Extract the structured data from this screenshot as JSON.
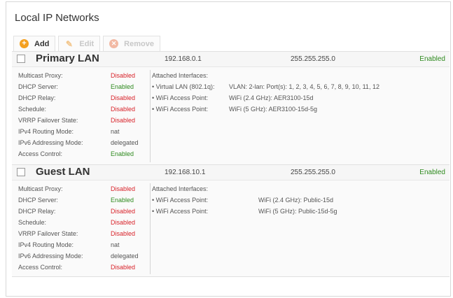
{
  "page": {
    "title": "Local IP Networks"
  },
  "toolbar": {
    "add_label": "Add",
    "edit_label": "Edit",
    "remove_label": "Remove"
  },
  "colors": {
    "enabled": "#2e8a1e",
    "disabled": "#d8232a",
    "add_accent": "#f4a020"
  },
  "networks": [
    {
      "name": "Primary LAN",
      "ip": "192.168.0.1",
      "netmask": "255.255.255.0",
      "state": "Enabled",
      "props": [
        {
          "key": "Multicast Proxy:",
          "value": "Disabled",
          "status": "red"
        },
        {
          "key": "DHCP Server:",
          "value": "Enabled",
          "status": "green"
        },
        {
          "key": "DHCP Relay:",
          "value": "Disabled",
          "status": "red"
        },
        {
          "key": "Schedule:",
          "value": "Disabled",
          "status": "red"
        },
        {
          "key": "VRRP Failover State:",
          "value": "Disabled",
          "status": "red"
        },
        {
          "key": "IPv4 Routing Mode:",
          "value": "nat",
          "status": "plain"
        },
        {
          "key": "IPv6 Addressing Mode:",
          "value": "delegated",
          "status": "plain"
        },
        {
          "key": "Access Control:",
          "value": "Enabled",
          "status": "green"
        }
      ],
      "attached_label": "Attached Interfaces:",
      "interfaces": [
        {
          "type": "• Virtual LAN (802.1q):",
          "detail": "VLAN: 2-lan: Port(s): 1, 2, 3, 4, 5, 6, 7, 8, 9, 10, 11, 12"
        },
        {
          "type": "• WiFi Access Point:",
          "detail": "WiFi (2.4 GHz): AER3100-15d"
        },
        {
          "type": "• WiFi Access Point:",
          "detail": "WiFi (5 GHz): AER3100-15d-5g"
        }
      ]
    },
    {
      "name": "Guest LAN",
      "ip": "192.168.10.1",
      "netmask": "255.255.255.0",
      "state": "Enabled",
      "props": [
        {
          "key": "Multicast Proxy:",
          "value": "Disabled",
          "status": "red"
        },
        {
          "key": "DHCP Server:",
          "value": "Enabled",
          "status": "green"
        },
        {
          "key": "DHCP Relay:",
          "value": "Disabled",
          "status": "red"
        },
        {
          "key": "Schedule:",
          "value": "Disabled",
          "status": "red"
        },
        {
          "key": "VRRP Failover State:",
          "value": "Disabled",
          "status": "red"
        },
        {
          "key": "IPv4 Routing Mode:",
          "value": "nat",
          "status": "plain"
        },
        {
          "key": "IPv6 Addressing Mode:",
          "value": "delegated",
          "status": "plain"
        },
        {
          "key": "Access Control:",
          "value": "Disabled",
          "status": "red"
        }
      ],
      "attached_label": "Attached Interfaces:",
      "interfaces": [
        {
          "type": "• WiFi Access Point:",
          "detail": "WiFi (2.4 GHz): Public-15d"
        },
        {
          "type": "• WiFi Access Point:",
          "detail": "WiFi (5 GHz): Public-15d-5g"
        }
      ]
    }
  ]
}
